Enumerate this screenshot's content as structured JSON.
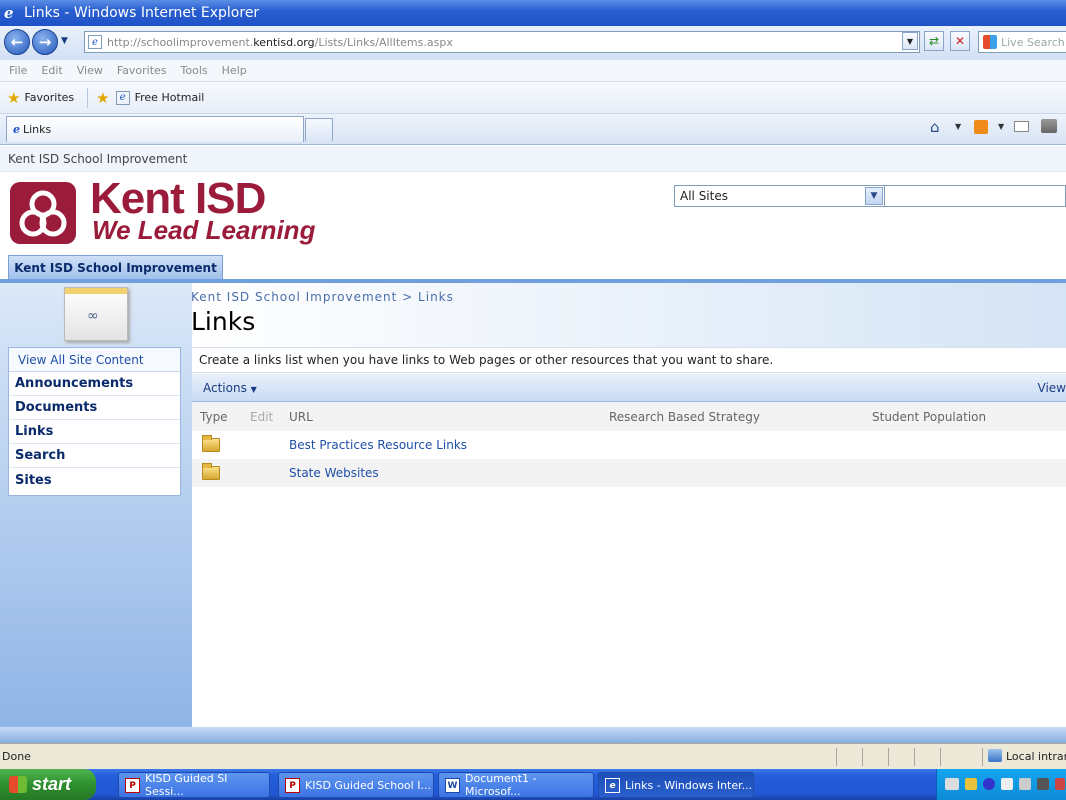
{
  "window": {
    "title": "Links - Windows Internet Explorer"
  },
  "browser": {
    "address_prefix": "http://schoolimprovement.",
    "address_domain": "kentisd.org",
    "address_suffix": "/Lists/Links/AllItems.aspx",
    "search_placeholder": "Live Search",
    "menu": [
      "File",
      "Edit",
      "View",
      "Favorites",
      "Tools",
      "Help"
    ],
    "favorites_label": "Favorites",
    "fav_link": "Free Hotmail",
    "tab_label": "Links"
  },
  "sharepoint": {
    "site_top": "Kent ISD School Improvement",
    "logo_line1": "Kent ISD",
    "logo_line2": "We Lead Learning",
    "scope_selected": "All Sites",
    "top_tab": "Kent ISD School Improvement",
    "breadcrumb": "Kent ISD School Improvement > Links",
    "page_title": "Links",
    "quicklaunch": {
      "view_all": "View All Site Content",
      "items": [
        "Announcements",
        "Documents",
        "Links",
        "Search",
        "Sites"
      ]
    },
    "description": "Create a links list when you have links to Web pages or other resources that you want to share.",
    "toolbar": {
      "actions": "Actions",
      "view": "View"
    },
    "columns": [
      "Type",
      "Edit",
      "URL",
      "Research Based Strategy",
      "Student Population"
    ],
    "rows": [
      {
        "url": "Best Practices Resource Links"
      },
      {
        "url": "State Websites"
      }
    ]
  },
  "status": {
    "text": "Done",
    "zone": "Local intranet"
  },
  "taskbar": {
    "start": "start",
    "tasks": [
      "KISD Guided SI Sessi...",
      "KISD Guided School I...",
      "Document1 - Microsof...",
      "Links - Windows Inter..."
    ]
  },
  "colors": {
    "brand": "#9a1b3a",
    "link": "#1f4fa8",
    "nav": "#0a2a6b"
  }
}
